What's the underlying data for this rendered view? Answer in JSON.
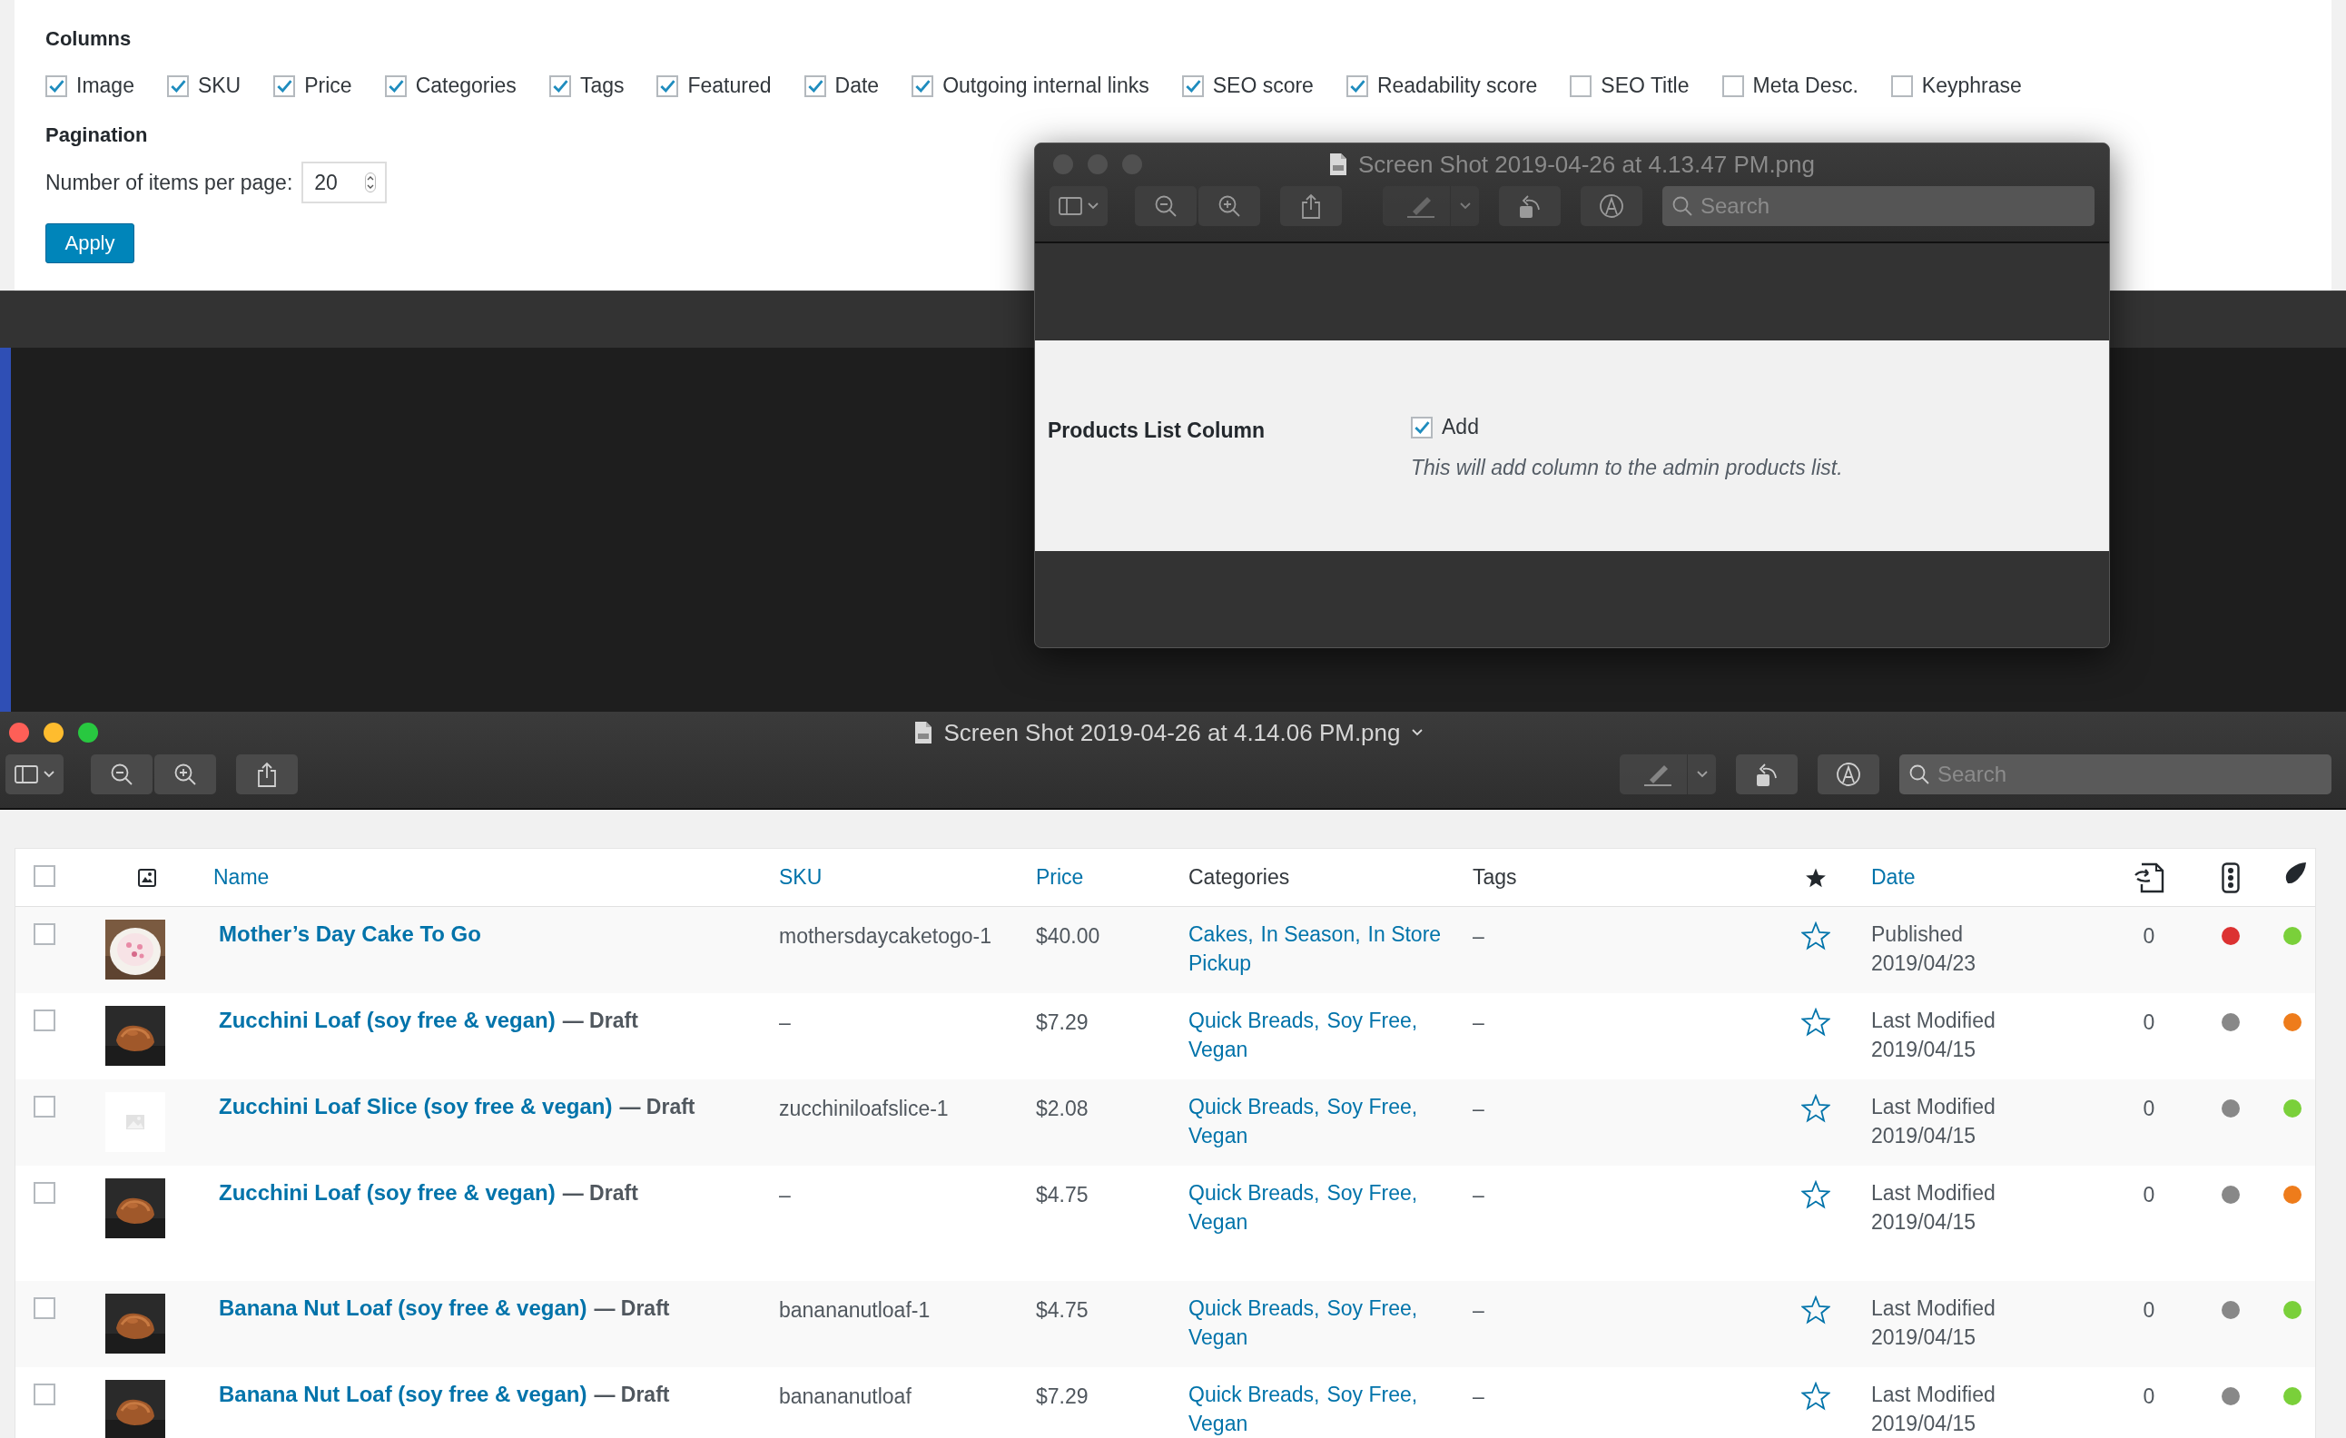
{
  "screen_options": {
    "columns_heading": "Columns",
    "columns": [
      {
        "label": "Image",
        "checked": true
      },
      {
        "label": "SKU",
        "checked": true
      },
      {
        "label": "Price",
        "checked": true
      },
      {
        "label": "Categories",
        "checked": true
      },
      {
        "label": "Tags",
        "checked": true
      },
      {
        "label": "Featured",
        "checked": true
      },
      {
        "label": "Date",
        "checked": true
      },
      {
        "label": "Outgoing internal links",
        "checked": true
      },
      {
        "label": "SEO score",
        "checked": true
      },
      {
        "label": "Readability score",
        "checked": true
      },
      {
        "label": "SEO Title",
        "checked": false
      },
      {
        "label": "Meta Desc.",
        "checked": false
      },
      {
        "label": "Keyphrase",
        "checked": false
      }
    ],
    "pagination_heading": "Pagination",
    "items_per_page_label": "Number of items per page:",
    "items_per_page": "20",
    "apply_button": "Apply"
  },
  "windows": [
    {
      "title": "Screen Shot 2019-04-26 at 4.13.47 PM.png",
      "active": false,
      "search": {
        "placeholder": "Search"
      },
      "setting": {
        "label": "Products List Column",
        "option": "Add",
        "checked": true,
        "description": "This will add column to the admin products list."
      }
    },
    {
      "title": "Screen Shot 2019-04-26 at 4.14.06 PM.png",
      "active": true,
      "search": {
        "placeholder": "Search"
      }
    }
  ],
  "products": {
    "select_all_checked": false,
    "columns": [
      {
        "label": "Name",
        "sortable": true
      },
      {
        "label": "SKU",
        "sortable": true
      },
      {
        "label": "Price",
        "sortable": true
      },
      {
        "label": "Categories",
        "sortable": false
      },
      {
        "label": "Tags",
        "sortable": false
      },
      {
        "label": "Date",
        "sortable": true
      }
    ],
    "rows": [
      {
        "checked": false,
        "thumbnail": {
          "kind": "picture"
        },
        "name": "Mother’s Day Cake To Go",
        "sku": "mothersdaycaketogo-1",
        "price": "$40.00",
        "categories": [
          "Cakes,",
          "In Season,",
          "In Store",
          "Pickup"
        ],
        "tags": "–",
        "featured": false,
        "date_status": "Published",
        "date": "2019/04/23",
        "links": "0",
        "seo": {
          "color": "#dc3232"
        },
        "readability": {
          "color": "#7ad03a"
        }
      },
      {
        "checked": false,
        "thumbnail": {
          "kind": "picture"
        },
        "name": "Zucchini Loaf (soy free & vegan)",
        "status": "— Draft",
        "sku": "–",
        "price": "$7.29",
        "categories": [
          "Quick Breads,",
          "Soy Free,",
          "Vegan"
        ],
        "tags": "–",
        "featured": false,
        "date_status": "Last Modified",
        "date": "2019/04/15",
        "links": "0",
        "seo": {
          "color": "#888888"
        },
        "readability": {
          "color": "#ee7c1b"
        }
      },
      {
        "checked": false,
        "thumbnail": {
          "kind": "placeholder"
        },
        "name": "Zucchini Loaf Slice (soy free & vegan)",
        "status": "— Draft",
        "sku": "zucchiniloafslice-1",
        "price": "$2.08",
        "categories": [
          "Quick Breads,",
          "Soy Free,",
          "Vegan"
        ],
        "tags": "–",
        "featured": false,
        "date_status": "Last Modified",
        "date": "2019/04/15",
        "links": "0",
        "seo": {
          "color": "#888888"
        },
        "readability": {
          "color": "#7ad03a"
        }
      },
      {
        "checked": false,
        "thumbnail": {
          "kind": "picture"
        },
        "name": "Zucchini Loaf (soy free & vegan)",
        "status": "— Draft",
        "sku": "–",
        "price": "$4.75",
        "categories": [
          "Quick Breads,",
          "Soy Free,",
          "Vegan"
        ],
        "tags": "–",
        "featured": false,
        "date_status": "Last Modified",
        "date": "2019/04/15",
        "links": "0",
        "seo": {
          "color": "#888888"
        },
        "readability": {
          "color": "#ee7c1b"
        }
      },
      {
        "checked": false,
        "thumbnail": {
          "kind": "picture"
        },
        "name": "Banana Nut Loaf (soy free & vegan)",
        "status": "— Draft",
        "sku": "banananutloaf-1",
        "price": "$4.75",
        "categories": [
          "Quick Breads,",
          "Soy Free,",
          "Vegan"
        ],
        "tags": "–",
        "featured": false,
        "date_status": "Last Modified",
        "date": "2019/04/15",
        "links": "0",
        "seo": {
          "color": "#888888"
        },
        "readability": {
          "color": "#7ad03a"
        }
      },
      {
        "checked": false,
        "thumbnail": {
          "kind": "picture"
        },
        "name": "Banana Nut Loaf (soy free & vegan)",
        "status": "— Draft",
        "sku": "banananutloaf",
        "price": "$7.29",
        "categories": [
          "Quick Breads,",
          "Soy Free,",
          "Vegan"
        ],
        "tags": "–",
        "featured": false,
        "date_status": "Last Modified",
        "date": "2019/04/15",
        "links": "0",
        "seo": {
          "color": "#888888"
        },
        "readability": {
          "color": "#7ad03a"
        }
      }
    ]
  }
}
